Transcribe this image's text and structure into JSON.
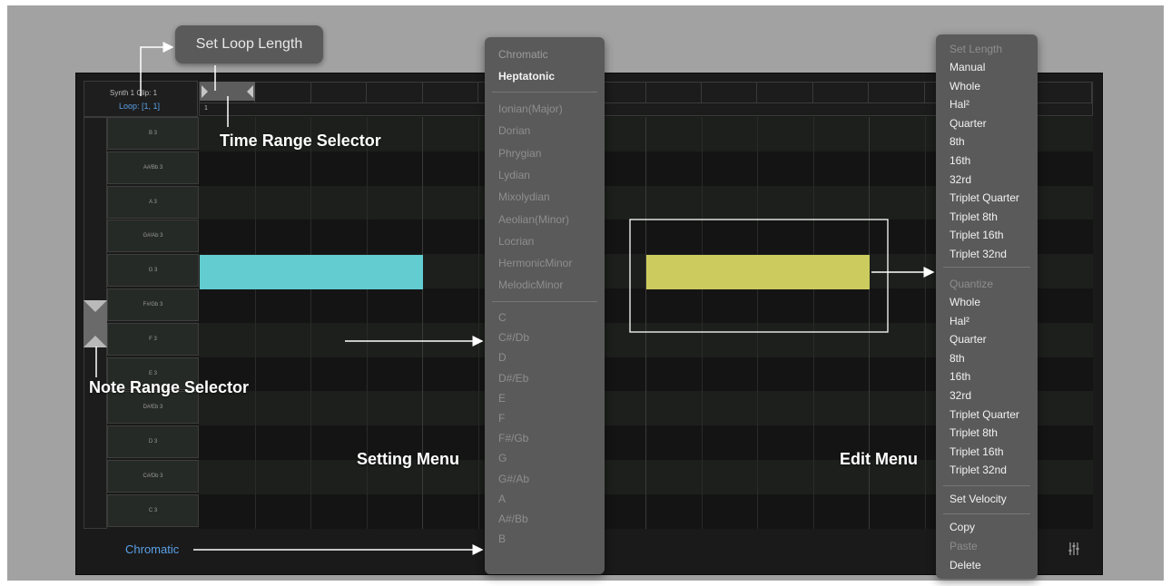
{
  "clip": {
    "title": "Synth 1 Clip: 1",
    "loop": "Loop: [1, 1]",
    "timeline_marker": "1"
  },
  "keys": [
    "B 3",
    "A#/Bb 3",
    "A 3",
    "G#/Ab 3",
    "G 3",
    "F#/Gb 3",
    "F 3",
    "E 3",
    "D#/Eb 3",
    "D 3",
    "C#/Db 3",
    "C 3"
  ],
  "notes": [
    {
      "color": "#62ccd0"
    },
    {
      "color": "#cccc5e"
    }
  ],
  "scale_button": "Chromatic",
  "settings_icon": "sliders-icon",
  "callouts": {
    "set_loop_length": "Set Loop Length",
    "time_range_selector": "Time Range Selector",
    "note_range_selector": "Note Range Selector",
    "setting_menu": "Setting Menu",
    "edit_menu": "Edit Menu"
  },
  "setting_menu": {
    "modes": [
      "Chromatic",
      "Heptatonic"
    ],
    "scales": [
      "Ionian(Major)",
      "Dorian",
      "Phrygian",
      "Lydian",
      "Mixolydian",
      "Aeolian(Minor)",
      "Locrian",
      "HermonicMinor",
      "MelodicMinor"
    ],
    "roots": [
      "C",
      "C#/Db",
      "D",
      "D#/Eb",
      "E",
      "F",
      "F#/Gb",
      "G",
      "G#/Ab",
      "A",
      "A#/Bb",
      "B"
    ]
  },
  "edit_menu": {
    "set_length_header": "Set Length",
    "lengths": [
      "Manual",
      "Whole",
      "Hal²",
      "Quarter",
      "8th",
      "16th",
      "32rd",
      "Triplet Quarter",
      "Triplet 8th",
      "Triplet 16th",
      "Triplet 32nd"
    ],
    "quantize_header": "Quantize",
    "quantize": [
      "Whole",
      "Hal²",
      "Quarter",
      "8th",
      "16th",
      "32rd",
      "Triplet Quarter",
      "Triplet 8th",
      "Triplet 16th",
      "Triplet 32nd"
    ],
    "set_velocity": "Set Velocity",
    "copy": "Copy",
    "paste": "Paste",
    "delete": "Delete"
  },
  "colors": {
    "accent_blue": "#5aa0e6",
    "note_cyan": "#62ccd0",
    "note_yellow": "#cccc5e"
  }
}
